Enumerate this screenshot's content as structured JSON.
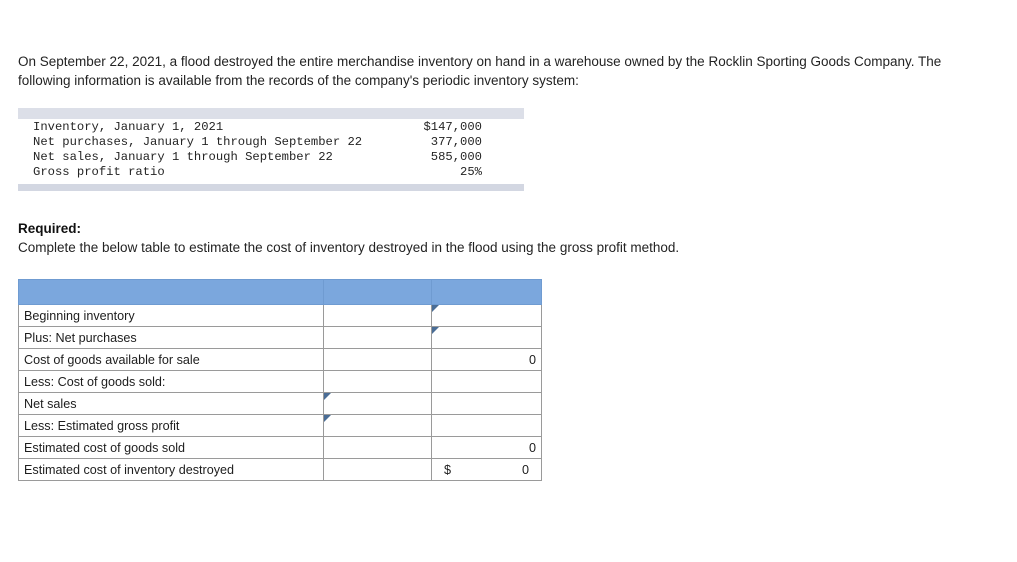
{
  "problem": {
    "statement": "On September 22, 2021, a flood destroyed the entire merchandise inventory on hand in a warehouse owned by the Rocklin Sporting Goods Company. The following information is available from the records of the company's periodic inventory system:"
  },
  "given_data": {
    "rows": [
      {
        "label": "Inventory, January 1, 2021",
        "value": "$147,000"
      },
      {
        "label": "Net purchases, January 1 through September 22",
        "value": "377,000"
      },
      {
        "label": "Net sales, January 1 through September 22",
        "value": "585,000"
      },
      {
        "label": "Gross profit ratio",
        "value": "25%"
      }
    ]
  },
  "required": {
    "heading": "Required:",
    "instruction": "Complete the below table to estimate the cost of inventory destroyed in the flood using the gross profit method."
  },
  "worksheet": {
    "header_label": "",
    "rows": [
      {
        "label": "Beginning inventory",
        "mid": "",
        "right": ""
      },
      {
        "label": "Plus: Net purchases",
        "mid": "",
        "right": ""
      },
      {
        "label": "Cost of goods available for sale",
        "mid": "",
        "right": "0"
      },
      {
        "label": "Less: Cost of goods sold:",
        "mid": "",
        "right": ""
      },
      {
        "label": "Net sales",
        "mid": "",
        "right": ""
      },
      {
        "label": "Less: Estimated gross profit",
        "mid": "",
        "right": ""
      },
      {
        "label": "Estimated cost of goods sold",
        "mid": "",
        "right": "0"
      },
      {
        "label": "Estimated cost of inventory destroyed",
        "mid": "",
        "right": "0"
      }
    ],
    "answer_currency_symbol": "$",
    "answer_value": "0"
  },
  "colors": {
    "header_blue": "#7ba7dd",
    "band_gray": "#dcdfe8",
    "input_border_blue": "#5b84b1",
    "answer_highlight_yellow": "#ffffaa"
  }
}
